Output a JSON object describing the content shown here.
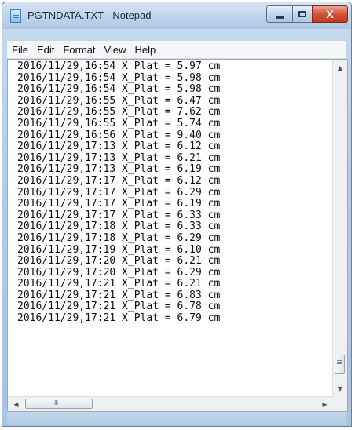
{
  "window": {
    "title": "PGTNDATA.TXT - Notepad",
    "close_glyph": "X"
  },
  "menubar": {
    "items": [
      "File",
      "Edit",
      "Format",
      "View",
      "Help"
    ]
  },
  "document": {
    "lines": [
      "2016/11/29,16:54 X_Plat = 5.97 cm",
      "2016/11/29,16:54 X_Plat = 5.98 cm",
      "2016/11/29,16:54 X_Plat = 5.98 cm",
      "2016/11/29,16:55 X_Plat = 6.47 cm",
      "2016/11/29,16:55 X_Plat = 7.62 cm",
      "2016/11/29,16:55 X_Plat = 5.74 cm",
      "2016/11/29,16:56 X_Plat = 9.40 cm",
      "2016/11/29,17:13 X_Plat = 6.12 cm",
      "2016/11/29,17:13 X_Plat = 6.21 cm",
      "2016/11/29,17:13 X_Plat = 6.19 cm",
      "2016/11/29,17:17 X_Plat = 6.12 cm",
      "2016/11/29,17:17 X_Plat = 6.29 cm",
      "2016/11/29,17:17 X_Plat = 6.19 cm",
      "2016/11/29,17:17 X_Plat = 6.33 cm",
      "2016/11/29,17:18 X_Plat = 6.33 cm",
      "2016/11/29,17:18 X_Plat = 6.29 cm",
      "2016/11/29,17:19 X_Plat = 6.10 cm",
      "2016/11/29,17:20 X_Plat = 6.21 cm",
      "2016/11/29,17:20 X_Plat = 6.29 cm",
      "2016/11/29,17:21 X_Plat = 6.21 cm",
      "2016/11/29,17:21 X_Plat = 6.83 cm",
      "2016/11/29,17:21 X_Plat = 6.78 cm",
      "2016/11/29,17:21 X_Plat = 6.79 cm"
    ]
  },
  "icons": {
    "app": "notepad-icon",
    "minimize": "minimize-icon",
    "maximize": "maximize-icon",
    "close": "close-icon"
  },
  "colors": {
    "titlebar": "#bdd3ec",
    "close_button": "#d2543a",
    "editor_background": "#ffffff"
  }
}
